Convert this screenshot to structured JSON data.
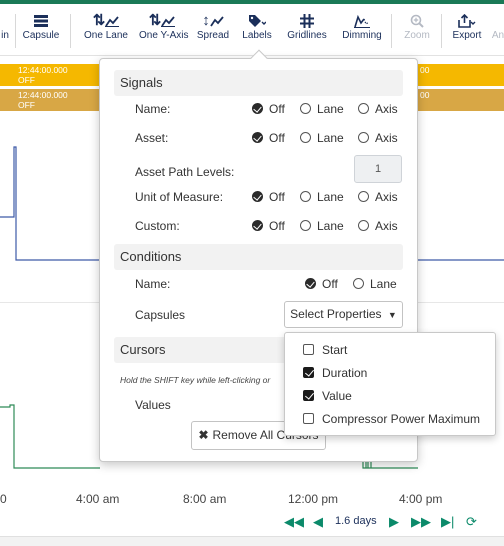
{
  "toolbar": {
    "items": [
      {
        "label": "in",
        "icon": "zoom-in-partial-icon",
        "disabled": false
      },
      {
        "label": "Capsule",
        "icon": "capsule-icon",
        "disabled": false
      },
      {
        "label": "One Lane",
        "icon": "one-lane-icon",
        "disabled": false
      },
      {
        "label": "One Y-Axis",
        "icon": "one-y-axis-icon",
        "disabled": false
      },
      {
        "label": "Spread",
        "icon": "spread-icon",
        "disabled": false
      },
      {
        "label": "Labels",
        "icon": "tag-icon",
        "disabled": false
      },
      {
        "label": "Gridlines",
        "icon": "gridlines-icon",
        "disabled": false
      },
      {
        "label": "Dimming",
        "icon": "dimming-icon",
        "disabled": false
      },
      {
        "label": "Zoom",
        "icon": "magnifier-icon",
        "disabled": true
      },
      {
        "label": "Export",
        "icon": "export-icon",
        "disabled": false
      },
      {
        "label": "An",
        "icon": "annotate-icon",
        "disabled": true
      }
    ]
  },
  "capsule_lanes": [
    {
      "time": "12:44:00.000",
      "state": "OFF",
      "right_time": "00",
      "right_state": "",
      "color": "#f5b800"
    },
    {
      "time": "12:44:00.000",
      "state": "OFF",
      "right_time": "00",
      "right_state": "",
      "color": "#d8a745"
    }
  ],
  "labels_panel": {
    "signals": {
      "title": "Signals",
      "rows": [
        {
          "label": "Name:",
          "options": [
            "Off",
            "Lane",
            "Axis"
          ],
          "selected": "Off"
        },
        {
          "label": "Asset:",
          "options": [
            "Off",
            "Lane",
            "Axis"
          ],
          "selected": "Off"
        },
        {
          "label": "Unit of Measure:",
          "options": [
            "Off",
            "Lane",
            "Axis"
          ],
          "selected": "Off"
        },
        {
          "label": "Custom:",
          "options": [
            "Off",
            "Lane",
            "Axis"
          ],
          "selected": "Off"
        }
      ],
      "asset_path_levels": {
        "label": "Asset Path Levels:",
        "value": "1"
      }
    },
    "conditions": {
      "title": "Conditions",
      "name": {
        "label": "Name:",
        "options": [
          "Off",
          "Lane"
        ],
        "selected": "Off"
      },
      "capsules": {
        "label": "Capsules",
        "button": "Select Properties"
      }
    },
    "cursors": {
      "title": "Cursors",
      "hint": "Hold the SHIFT key while left-clicking or",
      "values_label": "Values",
      "remove_button": "Remove All Cursors"
    }
  },
  "properties_dropdown": {
    "items": [
      {
        "label": "Start",
        "checked": false
      },
      {
        "label": "Duration",
        "checked": true
      },
      {
        "label": "Value",
        "checked": true
      },
      {
        "label": "Compressor Power Maximum",
        "checked": false
      }
    ]
  },
  "x_axis": {
    "ticks": [
      "0",
      "4:00 am",
      "8:00 am",
      "12:00 pm",
      "4:00 pm"
    ]
  },
  "navigation": {
    "duration": "1.6 days"
  },
  "colors": {
    "accent": "#1a7a57",
    "lane_yellow": "#f5b800",
    "lane_gold": "#d8a745",
    "blue_signal": "#3d5aa8",
    "green_signal": "#2e8b57",
    "nav_green": "#0b8a6a"
  }
}
